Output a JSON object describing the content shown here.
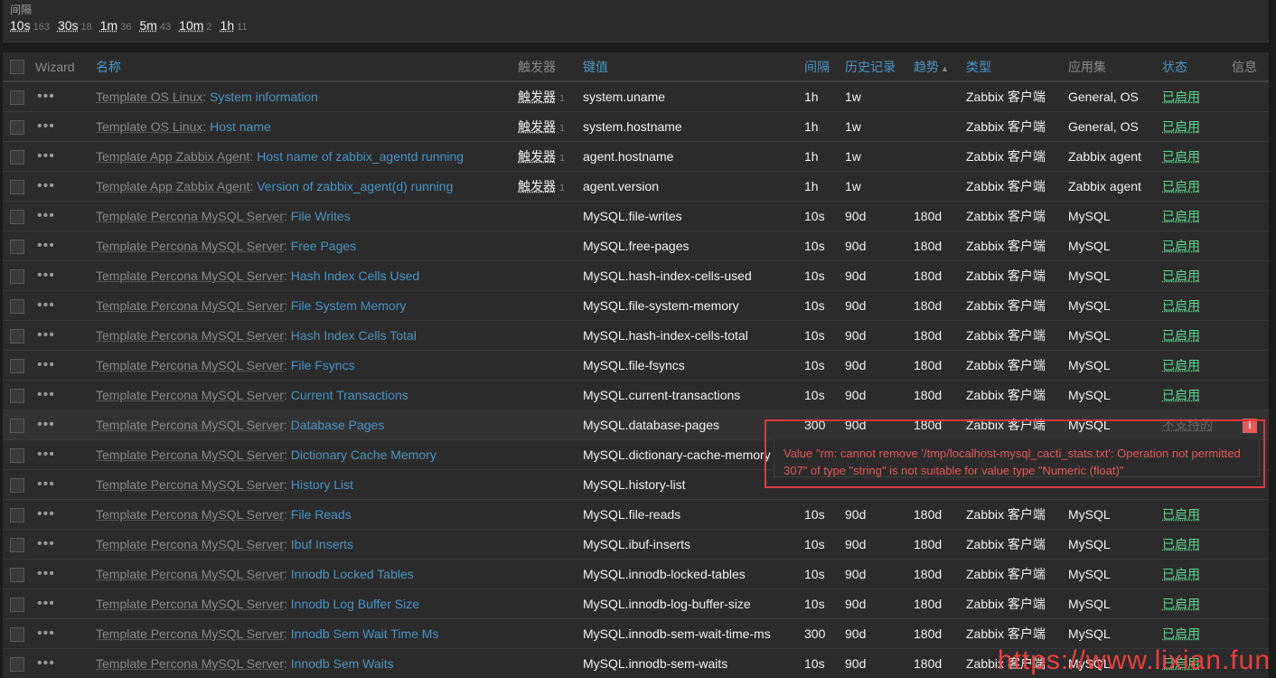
{
  "filter": {
    "title": "间隔",
    "intervals": [
      {
        "label": "10s",
        "count": "163"
      },
      {
        "label": "30s",
        "count": "18"
      },
      {
        "label": "1m",
        "count": "36"
      },
      {
        "label": "5m",
        "count": "43"
      },
      {
        "label": "10m",
        "count": "2"
      },
      {
        "label": "1h",
        "count": "11"
      }
    ]
  },
  "table": {
    "headers": {
      "wizard": "Wizard",
      "name": "名称",
      "triggers": "触发器",
      "key": "键值",
      "interval": "间隔",
      "history": "历史记录",
      "trends": "趋势",
      "type": "类型",
      "applications": "应用集",
      "status": "状态",
      "info": "信息"
    },
    "rows": [
      {
        "template": "Template OS Linux",
        "name": "System information",
        "trigger": "触发器",
        "trigger_count": "1",
        "key": "system.uname",
        "interval": "1h",
        "history": "1w",
        "trends": "",
        "type": "Zabbix 客户端",
        "app": "General, OS",
        "status": "已启用",
        "enabled": true
      },
      {
        "template": "Template OS Linux",
        "name": "Host name",
        "trigger": "触发器",
        "trigger_count": "1",
        "key": "system.hostname",
        "interval": "1h",
        "history": "1w",
        "trends": "",
        "type": "Zabbix 客户端",
        "app": "General, OS",
        "status": "已启用",
        "enabled": true
      },
      {
        "template": "Template App Zabbix Agent",
        "name": "Host name of zabbix_agentd running",
        "trigger": "触发器",
        "trigger_count": "1",
        "key": "agent.hostname",
        "interval": "1h",
        "history": "1w",
        "trends": "",
        "type": "Zabbix 客户端",
        "app": "Zabbix agent",
        "status": "已启用",
        "enabled": true
      },
      {
        "template": "Template App Zabbix Agent",
        "name": "Version of zabbix_agent(d) running",
        "trigger": "触发器",
        "trigger_count": "1",
        "key": "agent.version",
        "interval": "1h",
        "history": "1w",
        "trends": "",
        "type": "Zabbix 客户端",
        "app": "Zabbix agent",
        "status": "已启用",
        "enabled": true
      },
      {
        "template": "Template Percona MySQL Server",
        "name": "File Writes",
        "trigger": "",
        "trigger_count": "",
        "key": "MySQL.file-writes",
        "interval": "10s",
        "history": "90d",
        "trends": "180d",
        "type": "Zabbix 客户端",
        "app": "MySQL",
        "status": "已启用",
        "enabled": true
      },
      {
        "template": "Template Percona MySQL Server",
        "name": "Free Pages",
        "trigger": "",
        "trigger_count": "",
        "key": "MySQL.free-pages",
        "interval": "10s",
        "history": "90d",
        "trends": "180d",
        "type": "Zabbix 客户端",
        "app": "MySQL",
        "status": "已启用",
        "enabled": true
      },
      {
        "template": "Template Percona MySQL Server",
        "name": "Hash Index Cells Used",
        "trigger": "",
        "trigger_count": "",
        "key": "MySQL.hash-index-cells-used",
        "interval": "10s",
        "history": "90d",
        "trends": "180d",
        "type": "Zabbix 客户端",
        "app": "MySQL",
        "status": "已启用",
        "enabled": true
      },
      {
        "template": "Template Percona MySQL Server",
        "name": "File System Memory",
        "trigger": "",
        "trigger_count": "",
        "key": "MySQL.file-system-memory",
        "interval": "10s",
        "history": "90d",
        "trends": "180d",
        "type": "Zabbix 客户端",
        "app": "MySQL",
        "status": "已启用",
        "enabled": true
      },
      {
        "template": "Template Percona MySQL Server",
        "name": "Hash Index Cells Total",
        "trigger": "",
        "trigger_count": "",
        "key": "MySQL.hash-index-cells-total",
        "interval": "10s",
        "history": "90d",
        "trends": "180d",
        "type": "Zabbix 客户端",
        "app": "MySQL",
        "status": "已启用",
        "enabled": true
      },
      {
        "template": "Template Percona MySQL Server",
        "name": "File Fsyncs",
        "trigger": "",
        "trigger_count": "",
        "key": "MySQL.file-fsyncs",
        "interval": "10s",
        "history": "90d",
        "trends": "180d",
        "type": "Zabbix 客户端",
        "app": "MySQL",
        "status": "已启用",
        "enabled": true
      },
      {
        "template": "Template Percona MySQL Server",
        "name": "Current Transactions",
        "trigger": "",
        "trigger_count": "",
        "key": "MySQL.current-transactions",
        "interval": "10s",
        "history": "90d",
        "trends": "180d",
        "type": "Zabbix 客户端",
        "app": "MySQL",
        "status": "已启用",
        "enabled": true
      },
      {
        "template": "Template Percona MySQL Server",
        "name": "Database Pages",
        "trigger": "",
        "trigger_count": "",
        "key": "MySQL.database-pages",
        "interval": "300",
        "history": "90d",
        "trends": "180d",
        "type": "Zabbix 客户端",
        "app": "MySQL",
        "status": "不支持的",
        "enabled": false,
        "info": "i"
      },
      {
        "template": "Template Percona MySQL Server",
        "name": "Dictionary Cache Memory",
        "trigger": "",
        "trigger_count": "",
        "key": "MySQL.dictionary-cache-memory",
        "interval": "",
        "history": "",
        "trends": "",
        "type": "",
        "app": "",
        "status": "",
        "enabled": true
      },
      {
        "template": "Template Percona MySQL Server",
        "name": "History List",
        "trigger": "",
        "trigger_count": "",
        "key": "MySQL.history-list",
        "interval": "",
        "history": "",
        "trends": "",
        "type": "",
        "app": "",
        "status": "",
        "enabled": true
      },
      {
        "template": "Template Percona MySQL Server",
        "name": "File Reads",
        "trigger": "",
        "trigger_count": "",
        "key": "MySQL.file-reads",
        "interval": "10s",
        "history": "90d",
        "trends": "180d",
        "type": "Zabbix 客户端",
        "app": "MySQL",
        "status": "已启用",
        "enabled": true
      },
      {
        "template": "Template Percona MySQL Server",
        "name": "Ibuf Inserts",
        "trigger": "",
        "trigger_count": "",
        "key": "MySQL.ibuf-inserts",
        "interval": "10s",
        "history": "90d",
        "trends": "180d",
        "type": "Zabbix 客户端",
        "app": "MySQL",
        "status": "已启用",
        "enabled": true
      },
      {
        "template": "Template Percona MySQL Server",
        "name": "Innodb Locked Tables",
        "trigger": "",
        "trigger_count": "",
        "key": "MySQL.innodb-locked-tables",
        "interval": "10s",
        "history": "90d",
        "trends": "180d",
        "type": "Zabbix 客户端",
        "app": "MySQL",
        "status": "已启用",
        "enabled": true
      },
      {
        "template": "Template Percona MySQL Server",
        "name": "Innodb Log Buffer Size",
        "trigger": "",
        "trigger_count": "",
        "key": "MySQL.innodb-log-buffer-size",
        "interval": "10s",
        "history": "90d",
        "trends": "180d",
        "type": "Zabbix 客户端",
        "app": "MySQL",
        "status": "已启用",
        "enabled": true
      },
      {
        "template": "Template Percona MySQL Server",
        "name": "Innodb Sem Wait Time Ms",
        "trigger": "",
        "trigger_count": "",
        "key": "MySQL.innodb-sem-wait-time-ms",
        "interval": "300",
        "history": "90d",
        "trends": "180d",
        "type": "Zabbix 客户端",
        "app": "MySQL",
        "status": "已启用",
        "enabled": true
      },
      {
        "template": "Template Percona MySQL Server",
        "name": "Innodb Sem Waits",
        "trigger": "",
        "trigger_count": "",
        "key": "MySQL.innodb-sem-waits",
        "interval": "10s",
        "history": "90d",
        "trends": "180d",
        "type": "Zabbix 客户端",
        "app": "MySQL",
        "status": "已启用",
        "enabled": true
      }
    ]
  },
  "tooltip": {
    "message": "Value \"rm: cannot remove '/tmp/localhost-mysql_cacti_stats.txt': Operation not permitted 307\" of type \"string\" is not suitable for value type \"Numeric (float)\""
  },
  "watermark": "https://www.lixian.fun",
  "colors": {
    "link": "#4796c4",
    "enabled": "#59db8f",
    "error": "#e45959",
    "background": "#2b2b2b"
  }
}
